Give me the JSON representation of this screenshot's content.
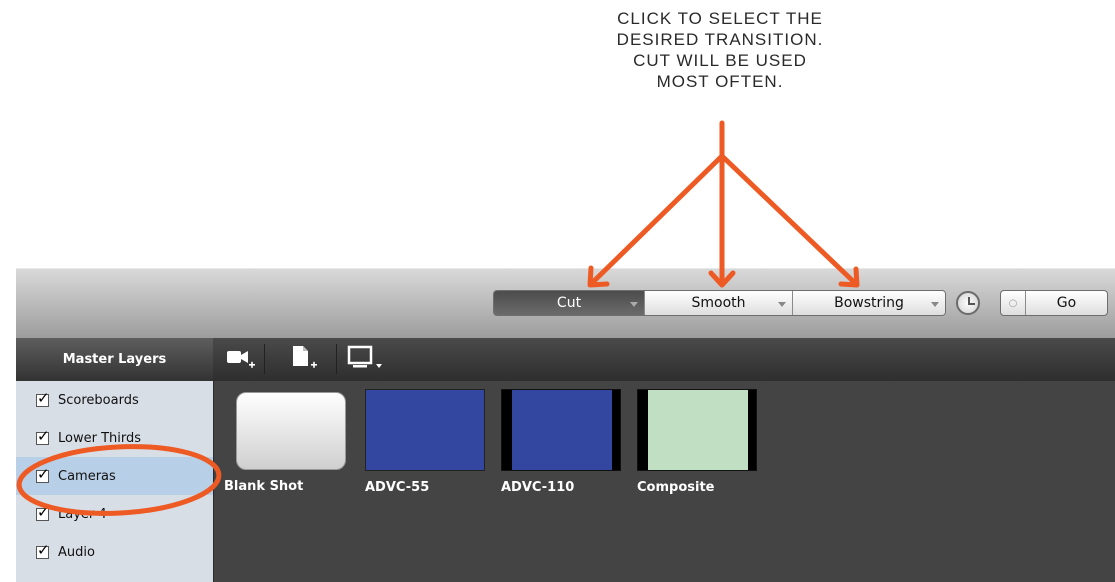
{
  "annotation": {
    "text_lines": [
      "CLICK TO SELECT THE",
      "DESIRED TRANSITION.",
      "CUT WILL BE USED",
      "MOST OFTEN."
    ],
    "arrow_color": "#ee5a24",
    "circle_color": "#ee5a24"
  },
  "toolbar": {
    "transitions": [
      {
        "label": "Cut",
        "active": true
      },
      {
        "label": "Smooth",
        "active": false
      },
      {
        "label": "Bowstring",
        "active": false
      }
    ],
    "clock_icon": "clock-icon",
    "go_label": "Go"
  },
  "sidebar": {
    "title": "Master Layers",
    "layers": [
      {
        "label": "Scoreboards",
        "checked": true
      },
      {
        "label": "Lower Thirds",
        "checked": true
      },
      {
        "label": "Cameras",
        "checked": true,
        "selected": true
      },
      {
        "label": "Layer 4",
        "checked": true
      },
      {
        "label": "Audio",
        "checked": true
      }
    ]
  },
  "content_toolbar": {
    "icons": [
      "add-camera-icon",
      "add-document-icon",
      "display-menu-icon"
    ]
  },
  "shots": [
    {
      "label": "Blank Shot",
      "kind": "blank"
    },
    {
      "label": "ADVC-55",
      "kind": "solid",
      "color": "#3347a0"
    },
    {
      "label": "ADVC-110",
      "kind": "letterbox",
      "color": "#3347a0"
    },
    {
      "label": "Composite",
      "kind": "letterbox",
      "color": "#c0dfc3"
    }
  ]
}
